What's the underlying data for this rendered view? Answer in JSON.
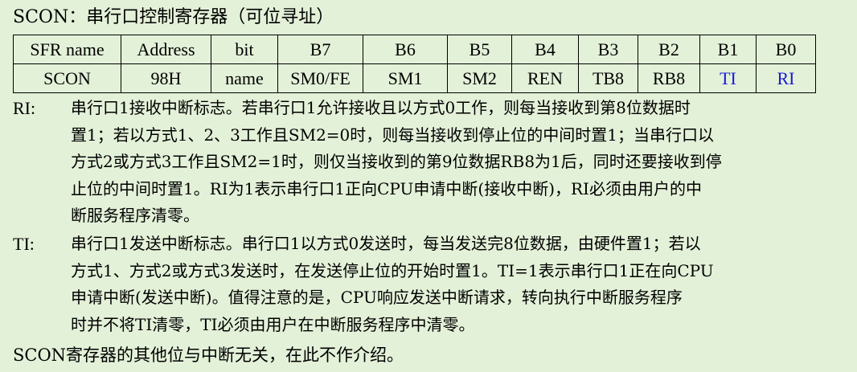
{
  "title": "SCON：串行口控制寄存器（可位寻址）",
  "register_table": {
    "header": [
      "SFR name",
      "Address",
      "bit",
      "B7",
      "B6",
      "B5",
      "B4",
      "B3",
      "B2",
      "B1",
      "B0"
    ],
    "row": [
      "SCON",
      "98H",
      "name",
      "SM0/FE",
      "SM1",
      "SM2",
      "REN",
      "TB8",
      "RB8",
      "TI",
      "RI"
    ],
    "highlight_color": "#1a1ad6"
  },
  "ri": {
    "term": "RI:",
    "lines": [
      "串行口1接收中断标志。若串行口1允许接收且以方式0工作，则每当接收到第8位数据时",
      "置1；若以方式1、2、3工作且SM2=0时，则每当接收到停止位的中间时置1；当串行口以",
      "方式2或方式3工作且SM2=1时，则仅当接收到的第9位数据RB8为1后，同时还要接收到停",
      "止位的中间时置1。RI为1表示串行口1正向CPU申请中断(接收中断)，RI必须由用户的中",
      "断服务程序清零。"
    ]
  },
  "ti": {
    "term": "TI:",
    "lines": [
      "串行口1发送中断标志。串行口1以方式0发送时，每当发送完8位数据，由硬件置1；若以",
      "方式1、方式2或方式3发送时，在发送停止位的开始时置1。TI=1表示串行口1正在向CPU",
      "申请中断(发送中断)。值得注意的是，CPU响应发送中断请求，转向执行中断服务程序",
      "时并不将TI清零，TI必须由用户在中断服务程序中清零。"
    ]
  },
  "footer": "SCON寄存器的其他位与中断无关，在此不作介绍。"
}
